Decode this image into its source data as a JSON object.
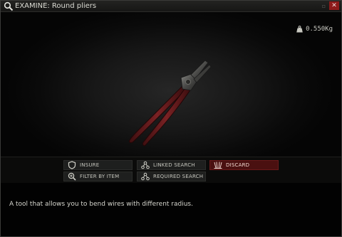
{
  "window": {
    "title": "EXAMINE: Round pliers",
    "minimize_glyph": "▫",
    "close_glyph": "✕",
    "accent_close": "#8c1a1a"
  },
  "item": {
    "weight": "0.550Kg",
    "image_icon": "round-pliers",
    "description": "A tool that allows you to bend wires with different radius."
  },
  "actions": [
    {
      "label": "INSURE",
      "icon": "shield-icon"
    },
    {
      "label": "LINKED SEARCH",
      "icon": "linked-search-icon"
    },
    {
      "label": "DISCARD",
      "icon": "discard-icon",
      "color": "#4a1010"
    },
    {
      "label": "FILTER BY ITEM",
      "icon": "magnifier-plus-icon"
    },
    {
      "label": "REQUIRED SEARCH",
      "icon": "required-search-icon"
    }
  ]
}
